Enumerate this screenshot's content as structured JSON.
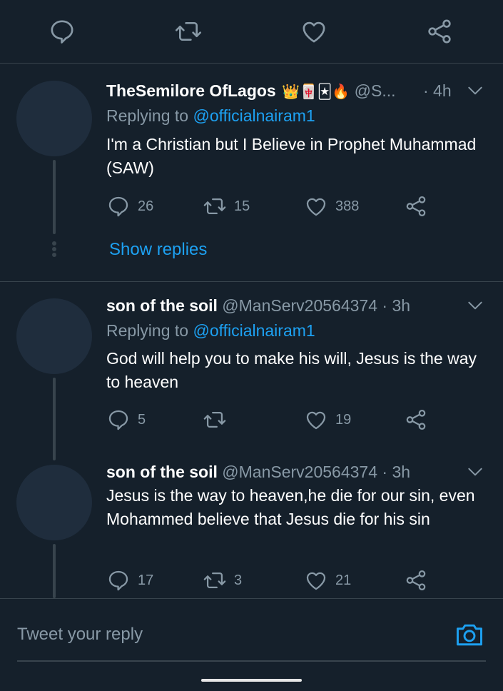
{
  "top_actions": {
    "reply_icon": "reply-icon",
    "retweet_icon": "retweet-icon",
    "like_icon": "heart-icon",
    "share_icon": "share-icon"
  },
  "tweets": [
    {
      "name": "TheSemilore OfLagos",
      "emojis": "👑🀄🃏🔥",
      "handle": "@S...",
      "time": "· 4h",
      "replying_prefix": "Replying to",
      "replying_to": "@officialnairam1",
      "text": "I'm a Christian but I Believe in Prophet Muhammad (SAW)",
      "replies": "26",
      "retweets": "15",
      "likes": "388",
      "show_replies": "Show replies"
    },
    {
      "name": "son of the soil",
      "handle": "@ManServ20564374",
      "time": "· 3h",
      "replying_prefix": "Replying to",
      "replying_to": "@officialnairam1",
      "text": "God will help you to make his will,  Jesus is the way to heaven",
      "replies": "5",
      "retweets": "",
      "likes": "19"
    },
    {
      "name": "son of the soil",
      "handle": "@ManServ20564374",
      "time": "· 3h",
      "text": "Jesus is the way to heaven,he die for our sin, even Mohammed believe that Jesus die for his sin",
      "replies": "17",
      "retweets": "3",
      "likes": "21"
    }
  ],
  "composer": {
    "placeholder": "Tweet your reply",
    "camera_icon": "camera-icon"
  },
  "colors": {
    "background": "#15202b",
    "accent": "#1da1f2",
    "muted": "#8899a6",
    "divider": "#38444d"
  }
}
